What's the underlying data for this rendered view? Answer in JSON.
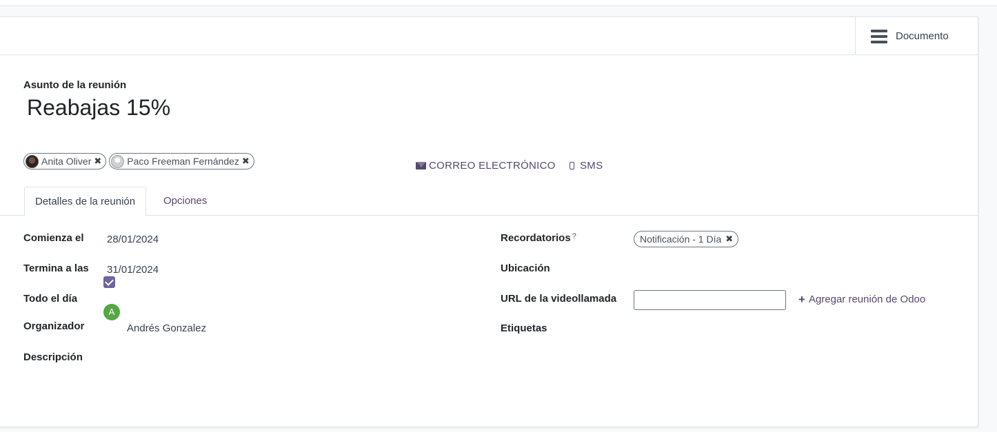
{
  "header": {
    "document_label": "Documento"
  },
  "subject": {
    "label": "Asunto de la reunión",
    "value": "Reabajas 15%"
  },
  "attendees": [
    {
      "name": "Anita Oliver",
      "remove_glyph": "✖"
    },
    {
      "name": "Paco Freeman Fernández",
      "remove_glyph": "✖"
    }
  ],
  "actions": {
    "email_label": "CORREO ELECTRÓNICO",
    "sms_label": "SMS"
  },
  "tabs": [
    {
      "label": "Detalles de la reunión",
      "active": true
    },
    {
      "label": "Opciones",
      "active": false
    }
  ],
  "details": {
    "starts_label": "Comienza el",
    "starts_value": "28/01/2024",
    "ends_label": "Termina a las",
    "ends_value": "31/01/2024",
    "allday_label": "Todo el día",
    "allday_checked": true,
    "organizer_label": "Organizador",
    "organizer_initial": "A",
    "organizer_name": "Andrés Gonzalez",
    "description_label": "Descripción"
  },
  "right": {
    "reminders_label": "Recordatorios",
    "reminders_help": "?",
    "reminder_tag": "Notificación - 1 Día",
    "reminder_remove": "✖",
    "location_label": "Ubicación",
    "videocall_label": "URL de la videollamada",
    "videocall_value": "",
    "add_meeting_plus": "+",
    "add_meeting_label": "Agregar reunión de Odoo",
    "tags_label": "Etiquetas"
  },
  "colors": {
    "accent": "#56476e",
    "checkbox": "#71639e",
    "organizer_avatar": "#54a743"
  }
}
